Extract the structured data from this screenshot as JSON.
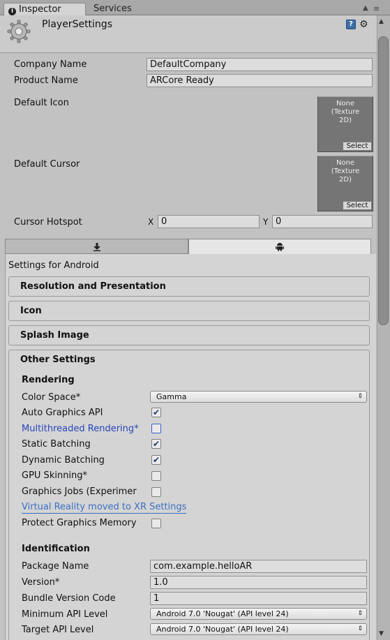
{
  "tabs": [
    {
      "label": "Inspector",
      "active": true
    },
    {
      "label": "Services",
      "active": false
    }
  ],
  "header": {
    "title": "PlayerSettings"
  },
  "fields": {
    "company_name": {
      "label": "Company Name",
      "value": "DefaultCompany"
    },
    "product_name": {
      "label": "Product Name",
      "value": "ARCore Ready"
    },
    "default_icon": {
      "label": "Default Icon",
      "texture_text": "None\n(Texture\n2D)",
      "button": "Select"
    },
    "default_cursor": {
      "label": "Default Cursor",
      "texture_text": "None\n(Texture\n2D)",
      "button": "Select"
    },
    "cursor_hotspot": {
      "label": "Cursor Hotspot",
      "x_label": "X",
      "x_value": "0",
      "y_label": "Y",
      "y_value": "0"
    }
  },
  "platform": {
    "settings_for": "Settings for Android",
    "selected": "android"
  },
  "foldouts": {
    "resolution": "Resolution and Presentation",
    "icon": "Icon",
    "splash": "Splash Image",
    "other": "Other Settings"
  },
  "rendering": {
    "header": "Rendering",
    "color_space": {
      "label": "Color Space*",
      "value": "Gamma"
    },
    "auto_graphics_api": {
      "label": "Auto Graphics API",
      "checked": true
    },
    "multithreaded_rendering": {
      "label": "Multithreaded Rendering*",
      "checked": false
    },
    "static_batching": {
      "label": "Static Batching",
      "checked": true
    },
    "dynamic_batching": {
      "label": "Dynamic Batching",
      "checked": true
    },
    "gpu_skinning": {
      "label": "GPU Skinning*",
      "checked": false
    },
    "graphics_jobs": {
      "label": "Graphics Jobs (Experimer",
      "checked": false
    },
    "vr_link": "Virtual Reality moved to XR Settings",
    "protect_graphics_memory": {
      "label": "Protect Graphics Memory",
      "checked": false
    }
  },
  "identification": {
    "header": "Identification",
    "package_name": {
      "label": "Package Name",
      "value": "com.example.helloAR"
    },
    "version": {
      "label": "Version*",
      "value": "1.0"
    },
    "bundle_version_code": {
      "label": "Bundle Version Code",
      "value": "1"
    },
    "minimum_api_level": {
      "label": "Minimum API Level",
      "value": "Android 7.0 'Nougat' (API level 24)"
    },
    "target_api_level": {
      "label": "Target API Level",
      "value": "Android 7.0 'Nougat' (API level 24)"
    }
  },
  "check_glyph": "✔"
}
